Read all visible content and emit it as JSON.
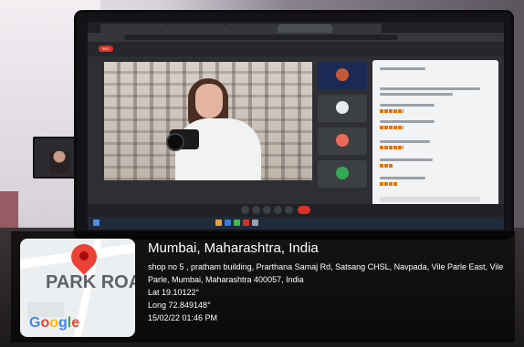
{
  "geotag": {
    "location_title": "Mumbai, Maharashtra, India",
    "address": "shop no 5 , pratham building, Prarthana Samaj Rd, Satsang CHSL, Navpada, Vile Parle East, Vile Parle, Mumbai, Maharashtra 400057, India",
    "latitude": "Lat 19.10122°",
    "longitude": "Long 72.849148°",
    "datetime": "15/02/22 01:46 PM",
    "map": {
      "place_label": "PARK ROA",
      "logo_letters": [
        "G",
        "o",
        "o",
        "g",
        "l",
        "e"
      ],
      "pin_icon": "map-pin-icon",
      "colors": {
        "pin": "#ea4335",
        "logo_blue": "#4285f4",
        "logo_red": "#ea4335",
        "logo_yellow": "#fbbc05",
        "logo_green": "#34a853"
      }
    }
  },
  "screen": {
    "rec_badge": "REC",
    "chat_icon": "chat-panel-icon",
    "end_call_icon": "end-call-icon"
  }
}
